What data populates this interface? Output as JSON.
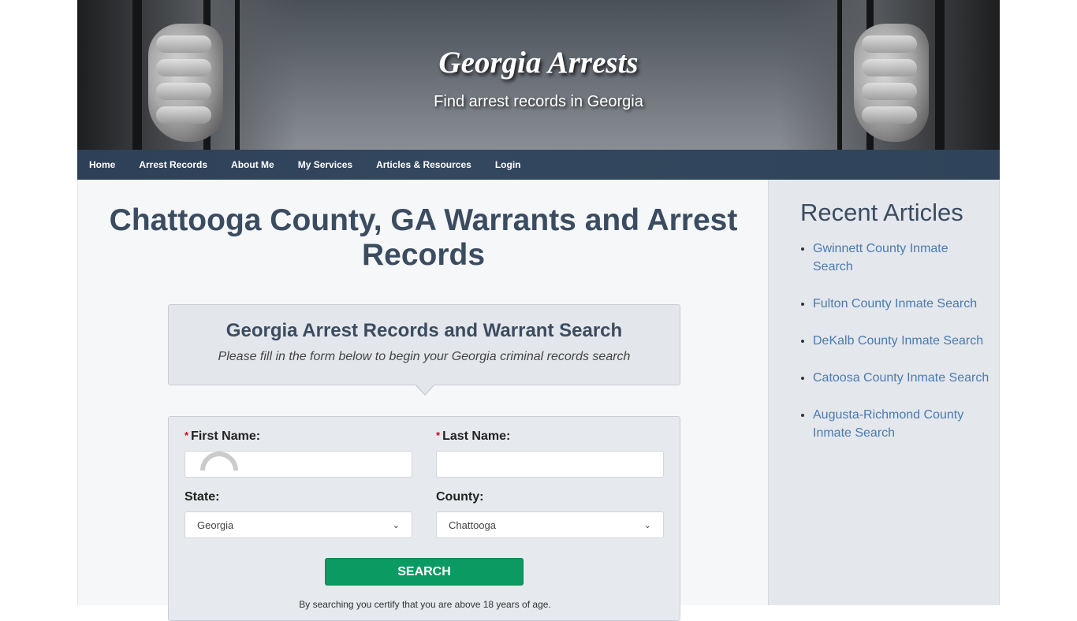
{
  "header": {
    "site_title": "Georgia Arrests",
    "tagline": "Find arrest records in Georgia"
  },
  "nav": {
    "items": [
      {
        "label": "Home"
      },
      {
        "label": "Arrest Records"
      },
      {
        "label": "About Me"
      },
      {
        "label": "My Services"
      },
      {
        "label": "Articles & Resources"
      },
      {
        "label": "Login"
      }
    ]
  },
  "main": {
    "page_title": "Chattooga County, GA Warrants and Arrest Records",
    "search_box": {
      "heading": "Georgia Arrest Records and Warrant Search",
      "subheading": "Please fill in the form below to begin your Georgia criminal records search"
    },
    "form": {
      "required_marker": "*",
      "first_name_label": "First Name:",
      "first_name_value": "",
      "last_name_label": "Last Name:",
      "last_name_value": "",
      "state_label": "State:",
      "state_value": "Georgia",
      "county_label": "County:",
      "county_value": "Chattooga",
      "search_button": "SEARCH",
      "disclaimer": "By searching you certify that you are above 18 years of age."
    }
  },
  "sidebar": {
    "heading": "Recent Articles",
    "articles": [
      {
        "label": "Gwinnett County Inmate Search"
      },
      {
        "label": "Fulton County Inmate Search"
      },
      {
        "label": "DeKalb County Inmate Search"
      },
      {
        "label": "Catoosa County Inmate Search"
      },
      {
        "label": "Augusta-Richmond County Inmate Search"
      }
    ]
  },
  "colors": {
    "nav_bg": "#2f435a",
    "title_text": "#3b4c61",
    "link": "#4a7bb0",
    "search_button": "#0b9a61",
    "required": "#d0021b"
  }
}
